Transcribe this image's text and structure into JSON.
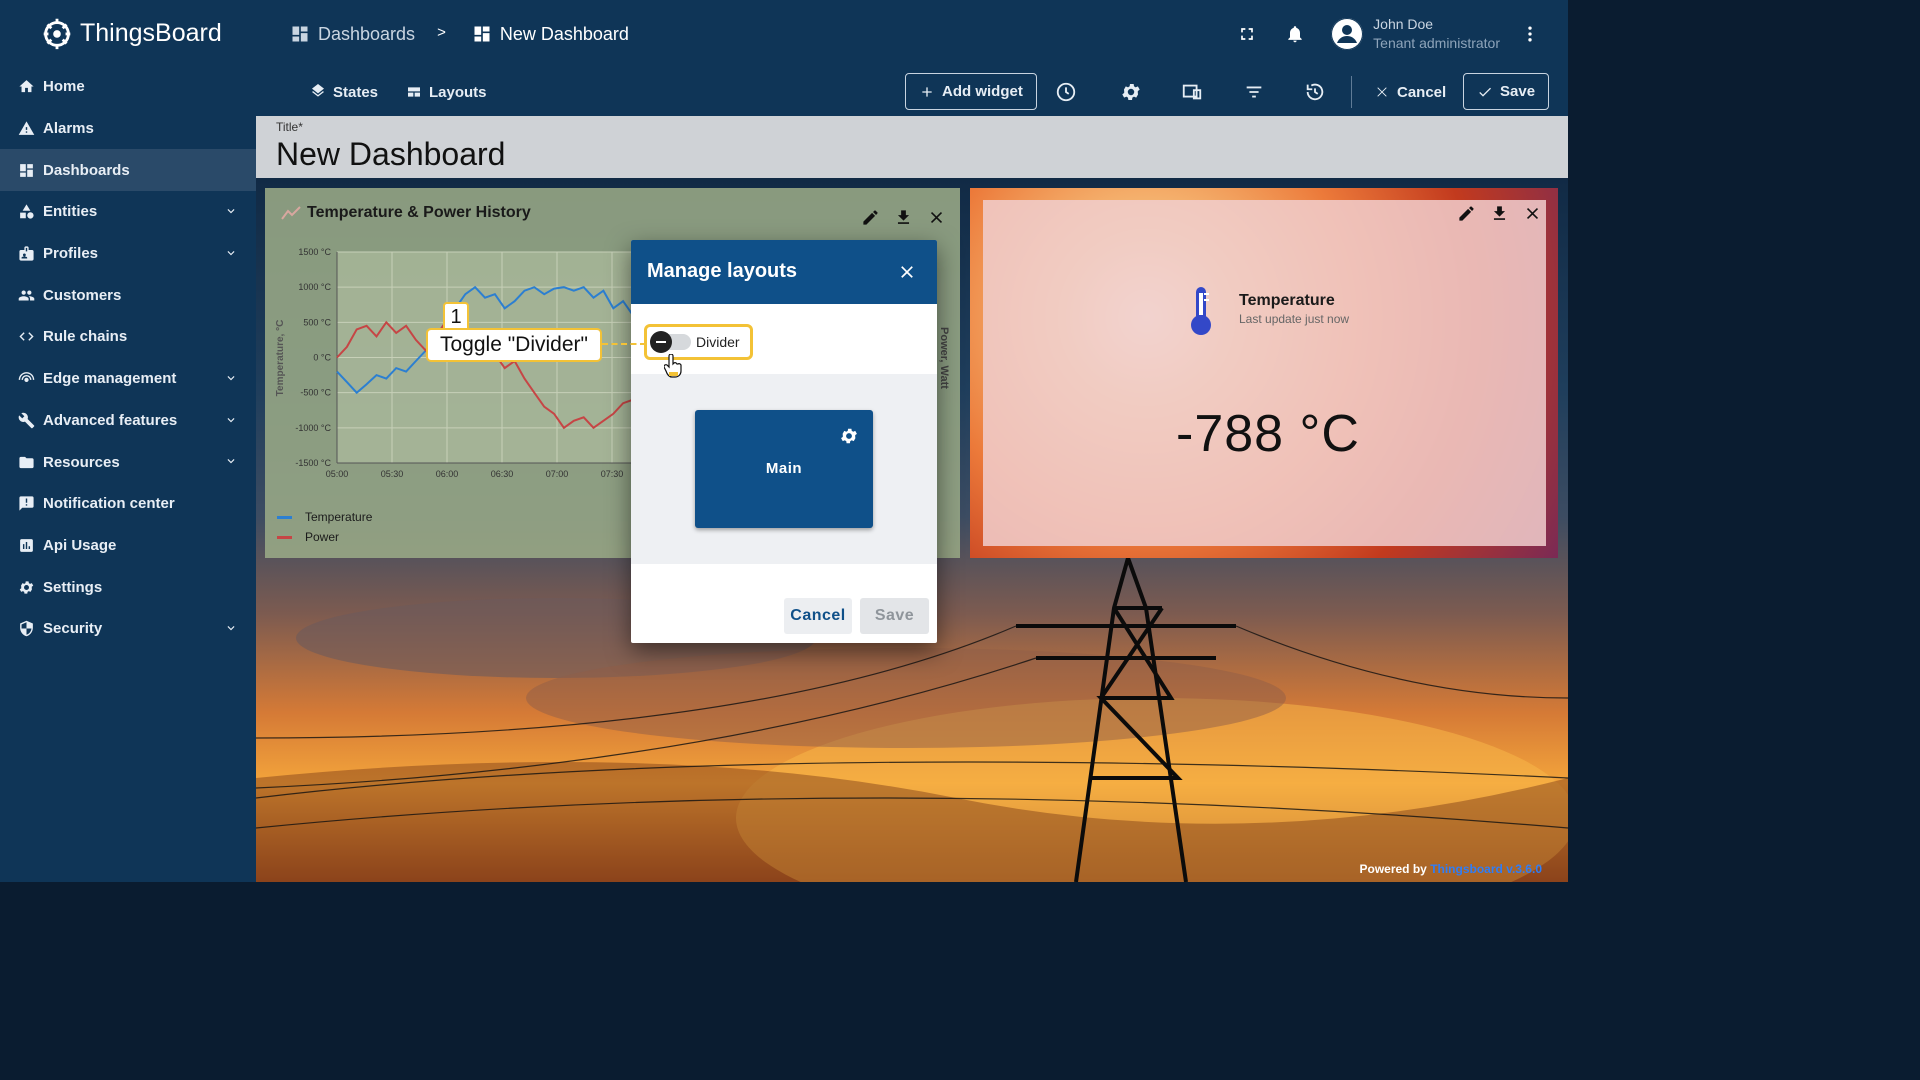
{
  "app": {
    "name": "ThingsBoard"
  },
  "sidebar": {
    "items": [
      {
        "label": "Home",
        "icon": "home-icon",
        "active": false,
        "expandable": false
      },
      {
        "label": "Alarms",
        "icon": "warning-icon",
        "active": false,
        "expandable": false
      },
      {
        "label": "Dashboards",
        "icon": "dashboard-icon",
        "active": true,
        "expandable": false
      },
      {
        "label": "Entities",
        "icon": "category-icon",
        "active": false,
        "expandable": true
      },
      {
        "label": "Profiles",
        "icon": "badge-icon",
        "active": false,
        "expandable": true
      },
      {
        "label": "Customers",
        "icon": "people-icon",
        "active": false,
        "expandable": false
      },
      {
        "label": "Rule chains",
        "icon": "code-icon",
        "active": false,
        "expandable": false
      },
      {
        "label": "Edge management",
        "icon": "router-icon",
        "active": false,
        "expandable": true
      },
      {
        "label": "Advanced features",
        "icon": "build-icon",
        "active": false,
        "expandable": true
      },
      {
        "label": "Resources",
        "icon": "folder-icon",
        "active": false,
        "expandable": true
      },
      {
        "label": "Notification center",
        "icon": "announcement-icon",
        "active": false,
        "expandable": false
      },
      {
        "label": "Api Usage",
        "icon": "insert-chart-icon",
        "active": false,
        "expandable": false
      },
      {
        "label": "Settings",
        "icon": "gear-icon",
        "active": false,
        "expandable": false
      },
      {
        "label": "Security",
        "icon": "security-icon",
        "active": false,
        "expandable": true
      }
    ]
  },
  "header": {
    "breadcrumb": [
      "Dashboards",
      "New Dashboard"
    ],
    "breadcrumb_separator": ">",
    "user": {
      "name": "John Doe",
      "role": "Tenant administrator"
    }
  },
  "toolbar": {
    "states_label": "States",
    "layouts_label": "Layouts",
    "add_widget_label": "Add widget",
    "cancel_label": "Cancel",
    "save_label": "Save",
    "icons": [
      "history-icon",
      "settings-icon",
      "devices-icon",
      "filter-icon",
      "restore-icon"
    ]
  },
  "dashboard": {
    "title_label": "Title*",
    "title_value": "New Dashboard"
  },
  "chart_widget": {
    "title": "Temperature & Power History",
    "legend": [
      {
        "name": "Temperature",
        "color": "#2c7fd1"
      },
      {
        "name": "Power",
        "color": "#c64545"
      }
    ]
  },
  "chart_data": {
    "type": "line",
    "title": "Temperature & Power History",
    "xlabel": "",
    "ylabel": "Temperature, °C",
    "ylabel_right": "Power, Watt",
    "x_ticks": [
      "05:00",
      "05:30",
      "06:00",
      "06:30",
      "07:00",
      "07:30"
    ],
    "y_ticks": [
      "1500 °C",
      "1000 °C",
      "500 °C",
      "0 °C",
      "-500 °C",
      "-1000 °C",
      "-1500 °C"
    ],
    "ylim": [
      -1500,
      1500
    ],
    "grid": true,
    "legend_position": "bottom-left",
    "series": [
      {
        "name": "Temperature",
        "color": "#2c7fd1",
        "x": [
          "05:00",
          "05:05",
          "05:10",
          "05:15",
          "05:20",
          "05:25",
          "05:30",
          "05:35",
          "05:40",
          "05:45",
          "05:50",
          "05:55",
          "06:00",
          "06:05",
          "06:10",
          "06:15",
          "06:20",
          "06:25",
          "06:30",
          "06:35",
          "06:40",
          "06:45",
          "06:50",
          "06:55",
          "07:00",
          "07:05",
          "07:10",
          "07:15",
          "07:20",
          "07:25",
          "07:30"
        ],
        "values": [
          -200,
          -350,
          -500,
          -380,
          -250,
          -300,
          -150,
          -200,
          -50,
          100,
          300,
          500,
          700,
          900,
          1000,
          850,
          900,
          700,
          800,
          950,
          1000,
          900,
          980,
          1000,
          950,
          1000,
          850,
          950,
          700,
          800,
          600
        ]
      },
      {
        "name": "Power",
        "color": "#c64545",
        "x": [
          "05:00",
          "05:05",
          "05:10",
          "05:15",
          "05:20",
          "05:25",
          "05:30",
          "05:35",
          "05:40",
          "05:45",
          "05:50",
          "05:55",
          "06:00",
          "06:05",
          "06:10",
          "06:15",
          "06:20",
          "06:25",
          "06:30",
          "06:35",
          "06:40",
          "06:45",
          "06:50",
          "06:55",
          "07:00",
          "07:05",
          "07:10",
          "07:15",
          "07:20",
          "07:25",
          "07:30"
        ],
        "values": [
          0,
          150,
          400,
          450,
          300,
          500,
          350,
          450,
          250,
          100,
          300,
          500,
          400,
          200,
          300,
          150,
          50,
          -150,
          -50,
          -300,
          -500,
          -700,
          -800,
          -1000,
          -900,
          -850,
          -1000,
          -900,
          -800,
          -650,
          -600
        ]
      }
    ]
  },
  "temperature_widget": {
    "name": "Temperature",
    "updated": "Last update just now",
    "value": "-788 °C"
  },
  "modal": {
    "title": "Manage layouts",
    "toggle_label": "Divider",
    "toggle_on": false,
    "layout_name": "Main",
    "cancel_label": "Cancel",
    "save_label": "Save"
  },
  "tutorial": {
    "step": "1",
    "callout_text": "Toggle \"Divider\"",
    "highlight_color": "#f3c236"
  },
  "footer": {
    "powered_prefix": "Powered by",
    "powered_link": "Thingsboard v.3.6.0"
  }
}
